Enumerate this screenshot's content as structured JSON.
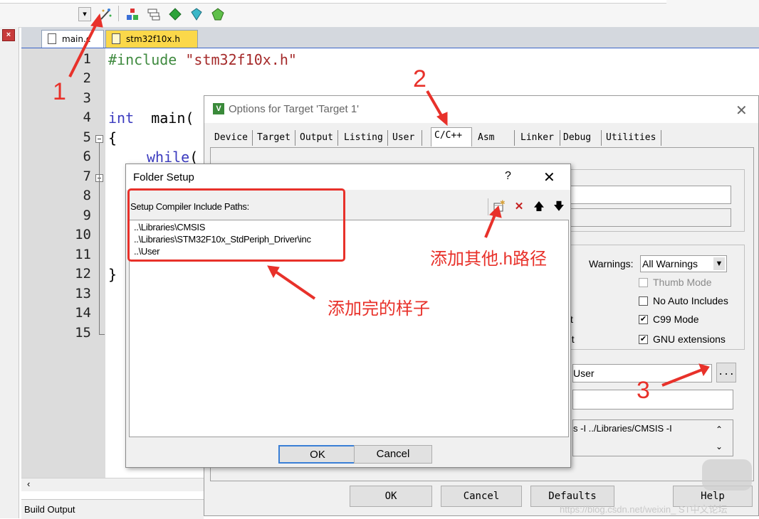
{
  "editor": {
    "tabs": [
      "main.c",
      "stm32f10x.h"
    ],
    "line_numbers": [
      "1",
      "2",
      "3",
      "4",
      "5",
      "6",
      "7",
      "8",
      "9",
      "10",
      "11",
      "12",
      "13",
      "14",
      "15"
    ],
    "code": {
      "l1_directive": "#include",
      "l1_file": "\"stm32f10x.h\"",
      "l4_type": "int",
      "l4_fn": "main(",
      "l5": "{",
      "l6_kw": "while",
      "l6_rest": "(",
      "l12": "}"
    },
    "build_output": "Build Output"
  },
  "options_dialog": {
    "title": "Options for Target 'Target 1'",
    "tabs": [
      "Device",
      "Target",
      "Output",
      "Listing",
      "User",
      "C/C++",
      "Asm",
      "Linker",
      "Debug",
      "Utilities"
    ],
    "active_tab": "C/C++",
    "warnings_label": "Warnings:",
    "warnings_value": "All Warnings",
    "checks": [
      {
        "label": "Thumb Mode",
        "checked": false,
        "disabled": true
      },
      {
        "label": "No Auto Includes",
        "checked": false,
        "disabled": false
      },
      {
        "label": "C99 Mode",
        "checked": true,
        "disabled": false
      },
      {
        "label": "GNU extensions",
        "checked": true,
        "disabled": false
      }
    ],
    "partial_t1": "t",
    "partial_t2": "nt",
    "include_paths_value": "User",
    "browse_label": "...",
    "misc_controls_value": "s -I ../Libraries/CMSIS -I",
    "buttons": {
      "ok": "OK",
      "cancel": "Cancel",
      "defaults": "Defaults",
      "help": "Help"
    }
  },
  "folder_setup": {
    "title": "Folder Setup",
    "help": "?",
    "close": "✕",
    "header": "Setup Compiler Include Paths:",
    "paths": [
      "..\\Libraries\\CMSIS",
      "..\\Libraries\\STM32F10x_StdPeriph_Driver\\inc",
      "..\\User"
    ],
    "buttons": {
      "ok": "OK",
      "cancel": "Cancel"
    }
  },
  "annotations": {
    "n1": "1",
    "n2": "2",
    "n3": "3",
    "add_other": "添加其他.h路径",
    "after_add": "添加完的样子",
    "color": "#e8312a"
  },
  "watermark": "https://blog.csdn.net/weixin_  ST中文论坛"
}
